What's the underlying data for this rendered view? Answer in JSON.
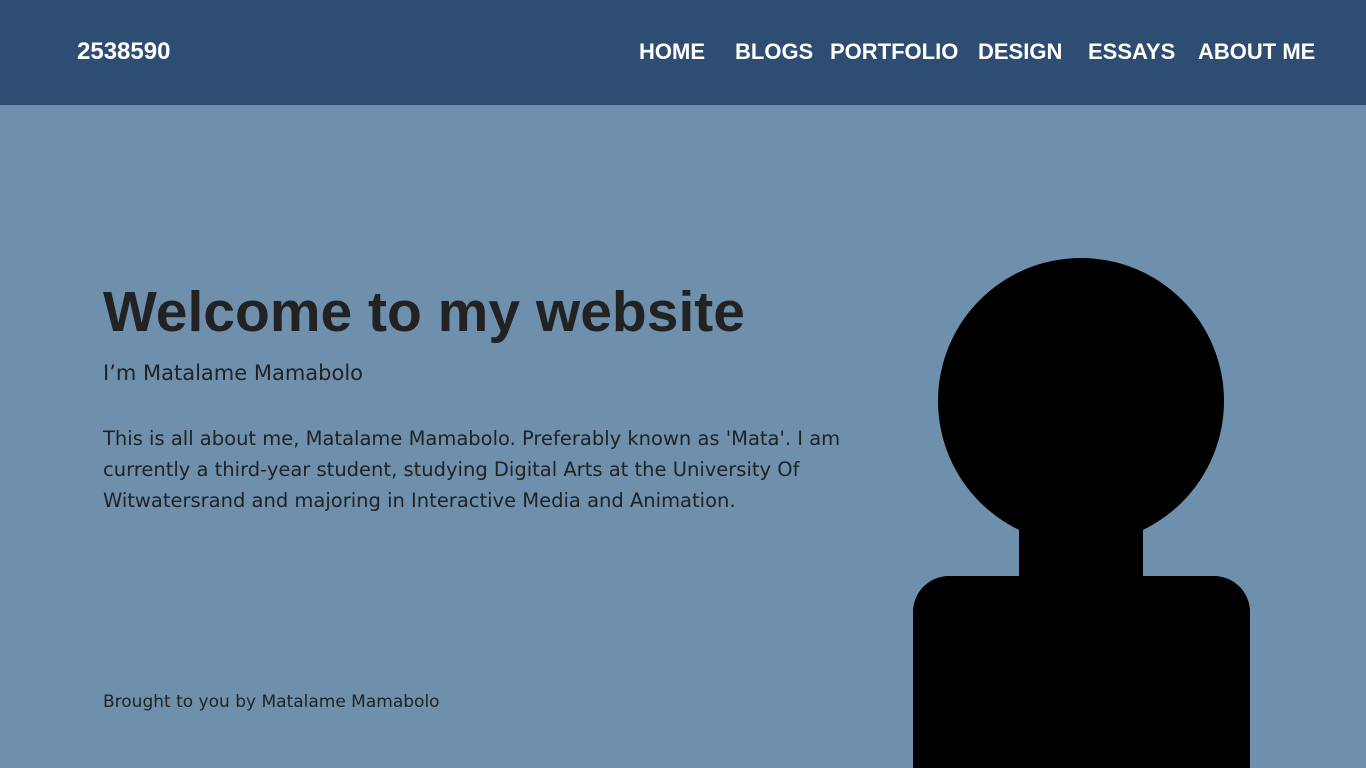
{
  "header": {
    "brand": "2538590",
    "nav": {
      "home": "HOME",
      "blogs": "BLOGS",
      "portfolio": "PORTFOLIO",
      "design": "DESIGN",
      "essays": "ESSAYS",
      "about": "ABOUT ME"
    }
  },
  "hero": {
    "title": "Welcome to my website",
    "subtitle": "I’m Matalame Mamabolo",
    "body": "This is all about me, Matalame Mamabolo. Preferably known as 'Mata'. I am currently a third-year student, studying Digital Arts at the University Of Witwatersrand and majoring in Interactive Media and Animation."
  },
  "footer": {
    "credit": "Brought to you by Matalame Mamabolo"
  },
  "avatar": {
    "icon": "person-silhouette-icon"
  },
  "colors": {
    "header_bg": "#2e4d73",
    "page_bg": "#6e90ad",
    "text": "#222222",
    "nav_text": "#ffffff",
    "avatar": "#000000"
  }
}
